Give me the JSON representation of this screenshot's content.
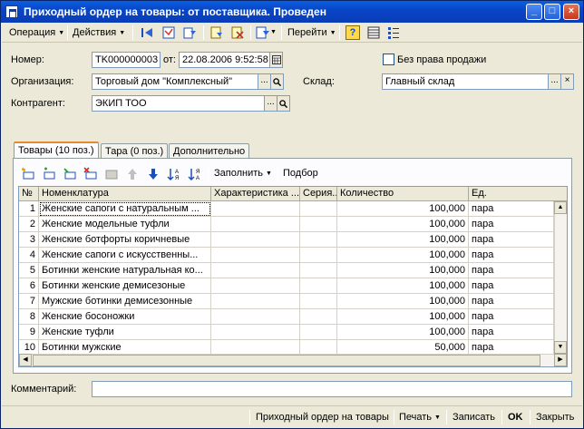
{
  "window": {
    "title": "Приходный ордер на товары: от поставщика. Проведен",
    "minimize_glyph": "_",
    "maximize_glyph": "□",
    "close_glyph": "×"
  },
  "toolbar": {
    "operation_label": "Операция",
    "actions_label": "Действия",
    "goto_label": "Перейти",
    "help_glyph": "?",
    "icons": [
      "go-to-first-icon",
      "document-view-icon",
      "refresh-icon",
      "move-document-icon",
      "copy-icon",
      "edit-icon",
      "structure-icon",
      "help-icon",
      "list-icon",
      "settings-list-icon"
    ]
  },
  "form": {
    "number_label": "Номер:",
    "number_value": "TK000000003",
    "date_label": "от:",
    "date_value": "22.08.2006  9:52:58",
    "no_sale_right_label": "Без права продажи",
    "organization_label": "Организация:",
    "organization_value": "Торговый дом \"Комплексный\"",
    "warehouse_label": "Склад:",
    "warehouse_value": "Главный склад",
    "counterparty_label": "Контрагент:",
    "counterparty_value": "ЭКИП ТОО",
    "select_glyph": "...",
    "clear_glyph": "×",
    "comment_label": "Комментарий:",
    "comment_value": ""
  },
  "tabs": [
    {
      "label": "Товары (10 поз.)"
    },
    {
      "label": "Тара (0 поз.)"
    },
    {
      "label": "Дополнительно"
    }
  ],
  "table_toolbar": {
    "fill_label": "Заполнить",
    "selection_label": "Подбор"
  },
  "table": {
    "columns": [
      "№",
      "Номенклатура",
      "Характеристика ...",
      "Серия...",
      "Количество",
      "Ед."
    ],
    "rows": [
      {
        "n": "1",
        "name": "Женские сапоги с натуральным ...",
        "char": "",
        "series": "",
        "qty": "100,000",
        "unit": "пара"
      },
      {
        "n": "2",
        "name": "Женские модельные туфли",
        "char": "",
        "series": "",
        "qty": "100,000",
        "unit": "пара"
      },
      {
        "n": "3",
        "name": "Женские ботфорты коричневые",
        "char": "",
        "series": "",
        "qty": "100,000",
        "unit": "пара"
      },
      {
        "n": "4",
        "name": "Женские сапоги с искусственны...",
        "char": "",
        "series": "",
        "qty": "100,000",
        "unit": "пара"
      },
      {
        "n": "5",
        "name": "Ботинки женские натуральная ко...",
        "char": "",
        "series": "",
        "qty": "100,000",
        "unit": "пара"
      },
      {
        "n": "6",
        "name": "Ботинки женские демисезоные",
        "char": "",
        "series": "",
        "qty": "100,000",
        "unit": "пара"
      },
      {
        "n": "7",
        "name": "Мужские ботинки демисезонные",
        "char": "",
        "series": "",
        "qty": "100,000",
        "unit": "пара"
      },
      {
        "n": "8",
        "name": "Женские босоножки",
        "char": "",
        "series": "",
        "qty": "100,000",
        "unit": "пара"
      },
      {
        "n": "9",
        "name": "Женские туфли",
        "char": "",
        "series": "",
        "qty": "100,000",
        "unit": "пара"
      },
      {
        "n": "10",
        "name": "Ботинки мужские",
        "char": "",
        "series": "",
        "qty": "50,000",
        "unit": "пара"
      }
    ]
  },
  "bottombar": {
    "print_form_label": "Приходный ордер на товары",
    "print_label": "Печать",
    "save_label": "Записать",
    "ok_label": "OK",
    "close_label": "Закрыть"
  }
}
